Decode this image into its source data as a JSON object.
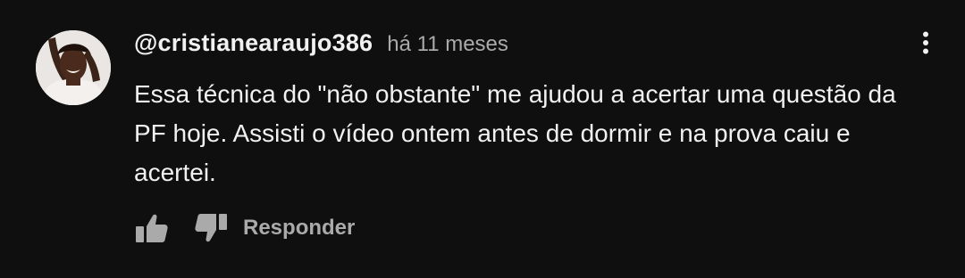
{
  "comment": {
    "author": "@cristianearaujo386",
    "time": "há 11 meses",
    "text": "Essa técnica do \"não obstante\" me ajudou a acertar uma questão da PF hoje. Assisti o vídeo ontem antes de dormir e na prova caiu e acertei."
  },
  "actions": {
    "reply_label": "Responder",
    "like_icon": "thumbs-up-icon",
    "dislike_icon": "thumbs-down-icon",
    "menu_icon": "more-vertical-icon"
  },
  "colors": {
    "background": "#0f0f0f",
    "text": "#f1f1f1",
    "secondary": "#aaaaaa"
  }
}
